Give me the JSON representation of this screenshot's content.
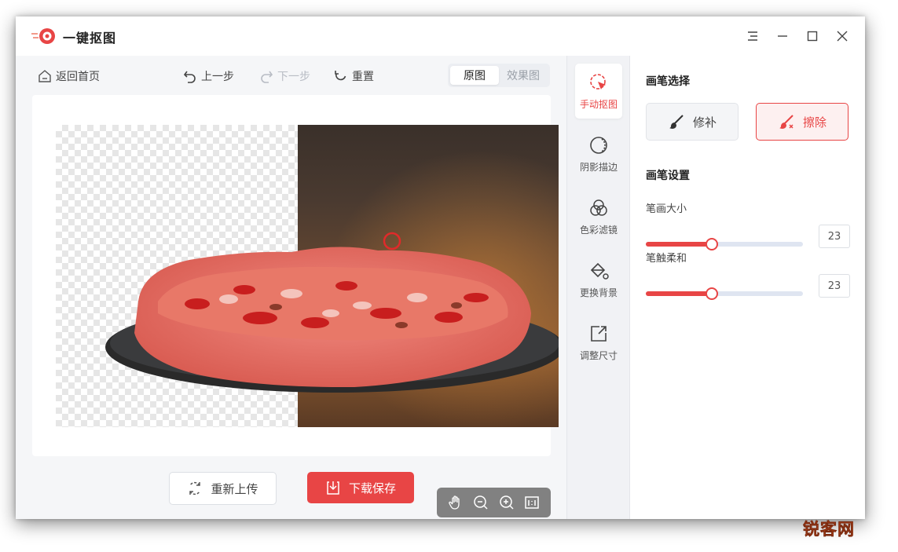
{
  "app": {
    "title": "一键抠图",
    "brand_color": "#e84545"
  },
  "window_controls": [
    "menu-icon",
    "minimize-icon",
    "maximize-icon",
    "close-icon"
  ],
  "toolbar": {
    "home": "返回首页",
    "undo": "上一步",
    "redo": "下一步",
    "reset": "重置",
    "view_original": "原图",
    "view_result": "效果图"
  },
  "canvas": {
    "zoom_tools": [
      "hand-icon",
      "zoom-out-icon",
      "zoom-in-icon",
      "actual-size-icon"
    ]
  },
  "actions": {
    "reupload": "重新上传",
    "download": "下载保存"
  },
  "sidebar": {
    "tabs": [
      {
        "label": "手动抠图",
        "icon": "manual-cutout-icon",
        "active": true
      },
      {
        "label": "阴影描边",
        "icon": "shadow-outline-icon",
        "active": false
      },
      {
        "label": "色彩滤镜",
        "icon": "color-filter-icon",
        "active": false
      },
      {
        "label": "更换背景",
        "icon": "fill-background-icon",
        "active": false
      },
      {
        "label": "调整尺寸",
        "icon": "resize-icon",
        "active": false
      }
    ]
  },
  "panel": {
    "brush_select_title": "画笔选择",
    "brush_repair": "修补",
    "brush_erase": "擦除",
    "brush_settings_title": "画笔设置",
    "brush_size_label": "笔画大小",
    "brush_size_value": "23",
    "brush_soft_label": "笔触柔和",
    "brush_soft_value": "23",
    "brush_size_fraction": 0.42,
    "brush_soft_fraction": 0.42
  },
  "watermark": "锐客网"
}
